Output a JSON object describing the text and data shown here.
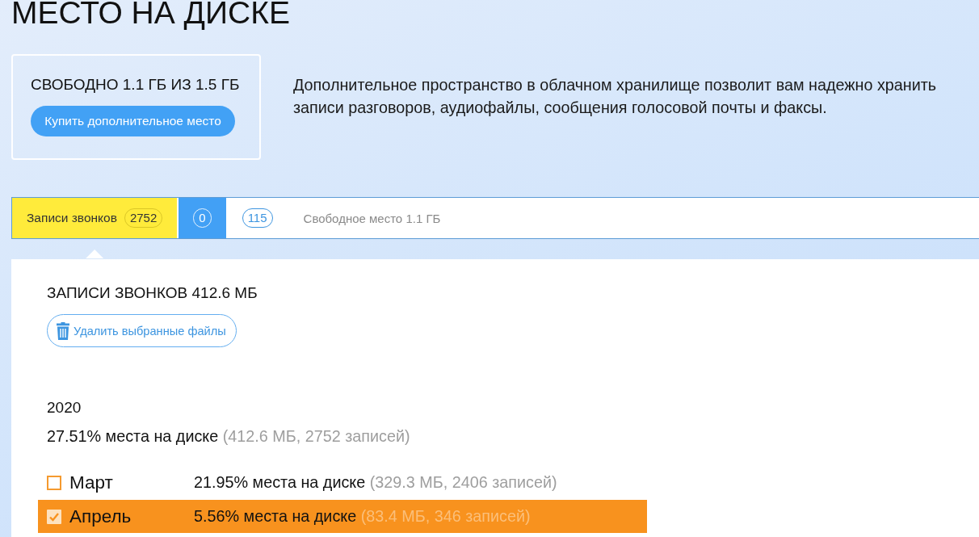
{
  "page": {
    "title": "МЕСТО НА ДИСКЕ"
  },
  "storage": {
    "summary": "СВОБОДНО 1.1 ГБ ИЗ 1.5 ГБ",
    "buy_button": "Купить дополнительное место",
    "description": "Дополнительное пространство в облачном хранилище позволит вам надежно хранить записи разговоров, аудиофайлы, сообщения голосовой почты и факсы."
  },
  "usage_tabs": [
    {
      "label": "Записи звонков",
      "count": "2752",
      "color": "#ffeb3b",
      "selected": true
    },
    {
      "count": "0",
      "color": "#42a0f5",
      "selected": false
    },
    {
      "count": "115",
      "color": "#ffffff",
      "selected": false
    }
  ],
  "free_space": "Свободное место 1.1 ГБ",
  "panel": {
    "title": "ЗАПИСИ ЗВОНКОВ 412.6 МБ",
    "delete_button": "Удалить выбранные файлы",
    "year": "2020",
    "share": "27.51% места на диске",
    "details": "(412.6 МБ, 2752 записей)",
    "months": [
      {
        "name": "Март",
        "share": "21.95% места на диске",
        "details": "(329.3 МБ, 2406 записей)",
        "checked": false
      },
      {
        "name": "Апрель",
        "share": "5.56% места на диске",
        "details": "(83.4 МБ, 346 записей)",
        "checked": true
      }
    ]
  }
}
